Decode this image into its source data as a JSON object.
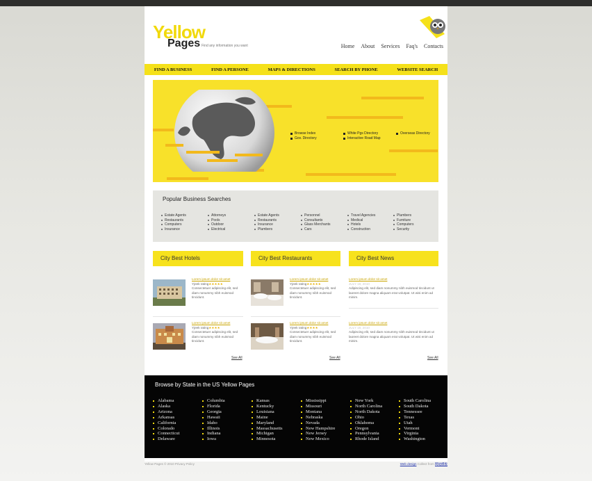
{
  "logo": {
    "word1": "Yellow",
    "word2": "Pages",
    "tagline": "Find any information you want"
  },
  "top_nav": [
    "Home",
    "About",
    "Services",
    "Faq's",
    "Contacts"
  ],
  "main_nav": [
    "FIND A BUSINESS",
    "FIND A PERSONE",
    "MAPS & DIRECTIONS",
    "SEARCH BY PHONE",
    "WEBSITE SEARCH"
  ],
  "hero_links": [
    [
      "Browse Index",
      "Gov. Directory"
    ],
    [
      "White Pgs Directory",
      "Interactive Road Map"
    ],
    [
      "Overseas Directory"
    ]
  ],
  "popular": {
    "title": "Popular Business Searches",
    "columns": [
      [
        "Estate Agents",
        "Restaurants",
        "Computers",
        "Insurance"
      ],
      [
        "Attorneys",
        "Pools",
        "Outdoor",
        "Electrical"
      ],
      [
        "Estate Agents",
        "Restaurants",
        "Insurance",
        "Plumbers"
      ],
      [
        "Personnel",
        "Consultants",
        "Glass Merchants",
        "Cars"
      ],
      [
        "Travel Agencies",
        "Medical",
        "Hotels",
        "Construction"
      ],
      [
        "Plumbers",
        "Furniture",
        "Computers",
        "Security"
      ]
    ]
  },
  "boxes": {
    "hotels": {
      "title": "City Best Hotels",
      "see_all": "See All",
      "items": [
        {
          "link": "Lorem ipsum dolor sit amet",
          "rating": "Yjeek rating",
          "stars": "★★★★★",
          "text": "Consectetuer adipiscing elit, sed diam nonummy nibh euismod tincidunt."
        },
        {
          "link": "Lorem ipsum dolor sit amet",
          "rating": "Yjeek rating",
          "stars": "★★★★",
          "text": "Consectetuer adipiscing elit, sed diam nonummy nibh euismod tincidunt."
        }
      ]
    },
    "restaurants": {
      "title": "City Best Restaurants",
      "see_all": "See All",
      "items": [
        {
          "link": "Lorem ipsum dolor sit amet",
          "rating": "Yjeek rating",
          "stars": "★★★★★",
          "text": "Consectetuer adipiscing elit, sed diam nonummy nibh euismod tincidunt."
        },
        {
          "link": "Lorem ipsum dolor sit amet",
          "rating": "Yjeek rating",
          "stars": "★★★★",
          "text": "Consectetuer adipiscing elit, sed diam nonummy nibh euismod tincidunt."
        }
      ]
    },
    "news": {
      "title": "City Best News",
      "see_all": "See All",
      "items": [
        {
          "link": "Lorem ipsum dolor sit amet",
          "date": "JULY 18, 2010",
          "text": "Adipiscing elit, sed diam nonummy nibh euismod tincidunt ut laoreet dolore magna aliquam erat volutpat. Ut wisi enim ad minim."
        },
        {
          "link": "Lorem ipsum dolor sit amet",
          "date": "JULY 18, 2010",
          "text": "Adipiscing elit, sed diam nonummy nibh euismod tincidunt ut laoreet dolore magna aliquam erat volutpat. Ut wisi enim ad minim."
        }
      ]
    }
  },
  "states": {
    "title": "Browse by State in the US Yellow Pages",
    "columns": [
      [
        "Alabama",
        "Alaska",
        "Arizona",
        "Arkansas",
        "California",
        "Colorado",
        "Connecticut",
        "Delaware"
      ],
      [
        "Columbia",
        "Florida",
        "Georgia",
        "Hawaii",
        "Idaho",
        "Illinois",
        "Indiana",
        "Iowa"
      ],
      [
        "Kansas",
        "Kentucky",
        "Louisiana",
        "Maine",
        "Maryland",
        "Massachusetts",
        "Michigan",
        "Minnesota"
      ],
      [
        "Mississippi",
        "Missouri",
        "Montana",
        "Nebraska",
        "Nevada",
        "New Hampshire",
        "New Jersey",
        "New Mexico"
      ],
      [
        "New York",
        "North Carolina",
        "North Dakota",
        "Ohio",
        "Oklahoma",
        "Oregon",
        "Pennsylvania",
        "Rhode Island"
      ],
      [
        "South Carolina",
        "South Dakota",
        "Tennessee",
        "Texas",
        "Utah",
        "Vermont",
        "Virginia",
        "Washington"
      ]
    ]
  },
  "footer": {
    "copyright": "Yellow Pages © 2010 Privacy Policy",
    "credit_link": "Web design",
    "credit_text": "Collect from",
    "credit_site": "网站模板"
  },
  "colors": {
    "accent_yellow": "#f7e21d",
    "hero_yellow": "#f8e12a",
    "stripe_orange": "#f2b91c",
    "footer_black": "#050505",
    "link_gold": "#c9a400"
  }
}
